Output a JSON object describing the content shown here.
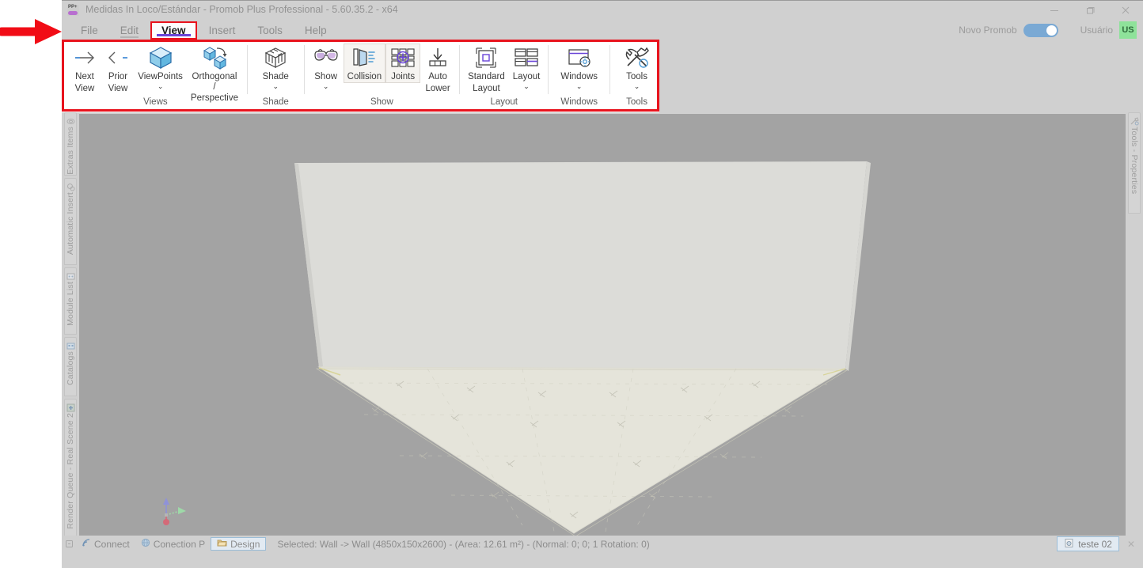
{
  "window": {
    "title": "Medidas In Loco/Estándar - Promob Plus Professional - 5.60.35.2 - x64",
    "app_icon": "promob-icon",
    "minimize_label": "—",
    "maximize_label": "❐",
    "close_label": "✕"
  },
  "menubar": {
    "items": [
      {
        "label": "File",
        "state": "normal"
      },
      {
        "label": "Edit",
        "state": "underlined"
      },
      {
        "label": "View",
        "state": "active"
      },
      {
        "label": "Insert",
        "state": "normal"
      },
      {
        "label": "Tools",
        "state": "normal"
      },
      {
        "label": "Help",
        "state": "normal"
      }
    ],
    "right": {
      "novo_promob_label": "Novo Promob",
      "toggle_state": "on",
      "user_label": "Usuário",
      "avatar_initials": "US",
      "avatar_color": "#8ee29a"
    }
  },
  "ribbon": {
    "accent_color": "#6a45d8",
    "highlight_box_color": "#e8131d",
    "groups": [
      {
        "name": "Views",
        "label": "Views",
        "buttons": [
          {
            "label_line1": "Next",
            "label_line2": "View",
            "icon": "arrow-right-icon",
            "caret": false,
            "toggled": false
          },
          {
            "label_line1": "Prior",
            "label_line2": "View",
            "icon": "arrow-left-icon",
            "caret": false,
            "toggled": false
          },
          {
            "label_line1": "ViewPoints",
            "label_line2": "",
            "icon": "cube-icon",
            "caret": true,
            "toggled": false
          },
          {
            "label_line1": "Orthogonal /",
            "label_line2": "Perspective",
            "icon": "ortho-perspective-icon",
            "caret": false,
            "toggled": false
          }
        ]
      },
      {
        "name": "Shade",
        "label": "Shade",
        "buttons": [
          {
            "label_line1": "Shade",
            "label_line2": "",
            "icon": "shaded-cube-icon",
            "caret": true,
            "toggled": false
          }
        ]
      },
      {
        "name": "Show",
        "label": "Show",
        "buttons": [
          {
            "label_line1": "Show",
            "label_line2": "",
            "icon": "glasses-3d-icon",
            "caret": true,
            "toggled": false
          },
          {
            "label_line1": "Collision",
            "label_line2": "",
            "icon": "collision-icon",
            "caret": false,
            "toggled": true
          },
          {
            "label_line1": "Joints",
            "label_line2": "",
            "icon": "joints-icon",
            "caret": false,
            "toggled": true
          },
          {
            "label_line1": "Auto",
            "label_line2": "Lower",
            "icon": "auto-lower-icon",
            "caret": false,
            "toggled": false
          }
        ]
      },
      {
        "name": "Layout",
        "label": "Layout",
        "buttons": [
          {
            "label_line1": "Standard",
            "label_line2": "Layout",
            "icon": "standard-layout-icon",
            "caret": false,
            "toggled": false
          },
          {
            "label_line1": "Layout",
            "label_line2": "",
            "icon": "layout-grid-icon",
            "caret": true,
            "toggled": false
          }
        ]
      },
      {
        "name": "Windows",
        "label": "Windows",
        "buttons": [
          {
            "label_line1": "Windows",
            "label_line2": "",
            "icon": "window-settings-icon",
            "caret": true,
            "toggled": false
          }
        ]
      },
      {
        "name": "Tools",
        "label": "Tools",
        "buttons": [
          {
            "label_line1": "Tools",
            "label_line2": "",
            "icon": "hammer-wrench-icon",
            "caret": true,
            "toggled": false
          }
        ]
      }
    ]
  },
  "left_sidebar": {
    "tabs": [
      {
        "label": "Extras Items",
        "icon": "extras-items-icon"
      },
      {
        "label": "Automatic Insert",
        "icon": "automatic-insert-icon"
      },
      {
        "label": "Module List",
        "icon": "module-list-icon"
      },
      {
        "label": "Catalogs",
        "icon": "catalogs-icon"
      },
      {
        "label": "Render Queue - Real Scene 2",
        "icon": "render-queue-icon"
      }
    ]
  },
  "right_sidebar": {
    "tabs": [
      {
        "label": "Tools - Properties",
        "icon": "tools-properties-icon"
      }
    ]
  },
  "viewport": {
    "background_color": "#a3a3a3",
    "wall_color": "#dcdcd8",
    "floor_color": "#e4e3d9",
    "axis_gizmo": {
      "x_color": "#d46a78",
      "y_color": "#9ed9a8",
      "z_color": "#8f92d8"
    }
  },
  "statusbar": {
    "buttons": [
      {
        "label": "Connect",
        "icon": "connect-icon",
        "selected": false
      },
      {
        "label": "Conection P",
        "icon": "globe-icon",
        "selected": false
      },
      {
        "label": "Design",
        "icon": "folder-icon",
        "selected": true
      }
    ],
    "status_text": "Selected: Wall -> Wall (4850x150x2600) - (Area: 12.61 m²) - (Normal: 0; 0; 1 Rotation: 0)",
    "document_tab": {
      "label": "teste 02",
      "icon": "document-icon",
      "close_label": "✕"
    }
  }
}
